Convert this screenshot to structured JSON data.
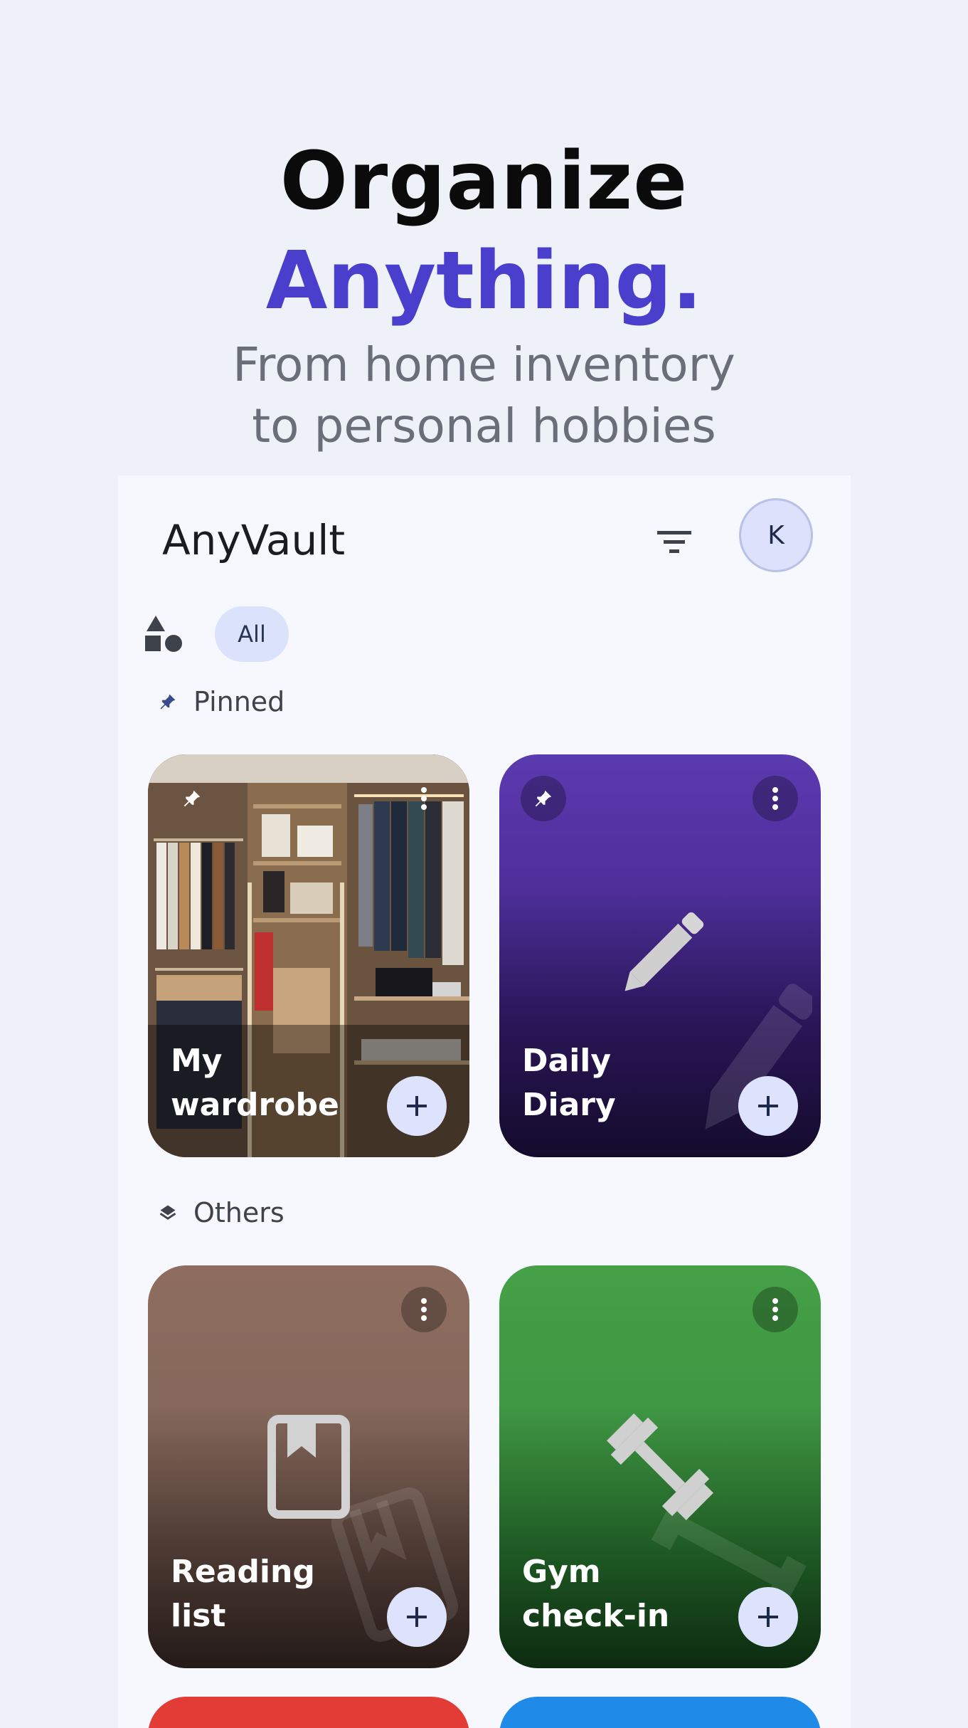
{
  "hero": {
    "title": "Organize",
    "accent": "Anything.",
    "subtitle_line1": "From home inventory",
    "subtitle_line2": "to personal hobbies"
  },
  "appbar": {
    "title": "AnyVault",
    "avatar_initial": "K"
  },
  "filters": {
    "chip_all": "All"
  },
  "sections": {
    "pinned": "Pinned",
    "others": "Others"
  },
  "cards": {
    "wardrobe": "My wardrobe",
    "diary": "Daily Diary",
    "reading": "Reading list",
    "gym_line1": "Gym",
    "gym_line2": "check-in"
  },
  "colors": {
    "accent": "#4a3fcc",
    "diary": "#5b3ab0",
    "reading": "#8e6d60",
    "gym": "#45a047",
    "red": "#e33b35",
    "blue": "#1f8ae8"
  }
}
